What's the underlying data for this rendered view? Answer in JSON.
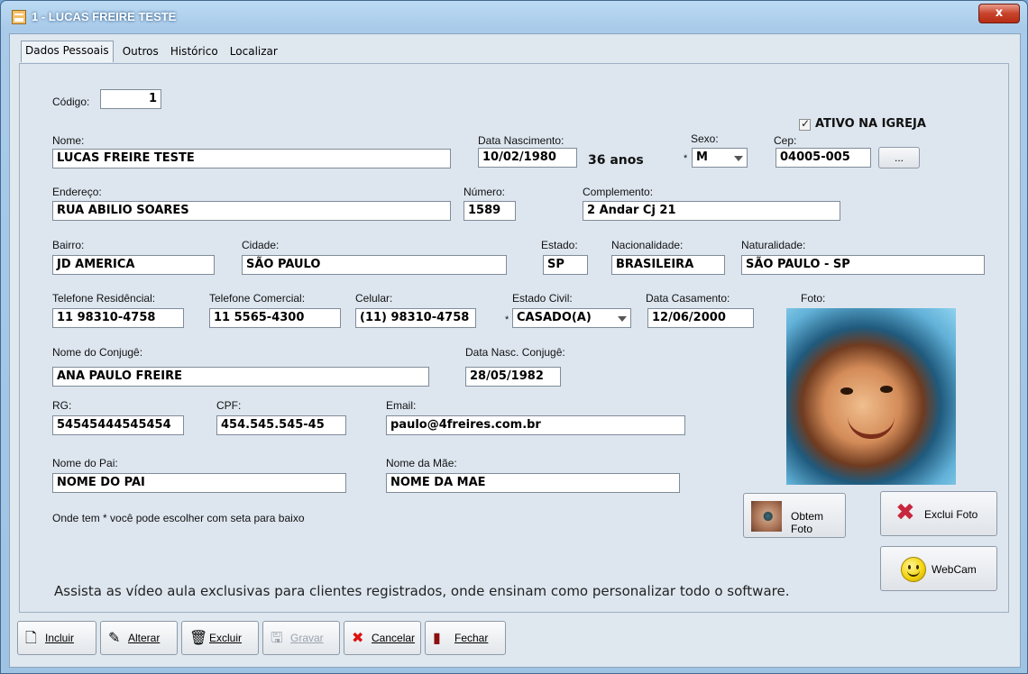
{
  "window": {
    "title": "1 - LUCAS FREIRE TESTE",
    "close": "x"
  },
  "tabs": [
    "Dados Pessoais",
    "Outros",
    "Histórico",
    "Localizar"
  ],
  "codigo": {
    "label": "Código:",
    "value": "1"
  },
  "ativo": {
    "label": "ATIVO NA IGREJA",
    "checked": true
  },
  "nome": {
    "label": "Nome:",
    "value": "LUCAS FREIRE TESTE"
  },
  "nascimento": {
    "label": "Data Nascimento:",
    "value": "10/02/1980",
    "age": "36 anos"
  },
  "sexo": {
    "label": "Sexo:",
    "value": "M"
  },
  "cep": {
    "label": "Cep:",
    "value": "04005-005",
    "button": "..."
  },
  "endereco": {
    "label": "Endereço:",
    "value": "RUA ABILIO SOARES"
  },
  "numero": {
    "label": "Número:",
    "value": "1589"
  },
  "complemento": {
    "label": "Complemento:",
    "value": "2 Andar Cj 21"
  },
  "bairro": {
    "label": "Bairro:",
    "value": "JD AMERICA"
  },
  "cidade": {
    "label": "Cidade:",
    "value": "SÃO PAULO"
  },
  "estado": {
    "label": "Estado:",
    "value": "SP"
  },
  "nacionalidade": {
    "label": "Nacionalidade:",
    "value": "BRASILEIRA"
  },
  "naturalidade": {
    "label": "Naturalidade:",
    "value": "SÃO PAULO - SP"
  },
  "tel_res": {
    "label": "Telefone Residêncial:",
    "value": "11 98310-4758"
  },
  "tel_com": {
    "label": "Telefone Comercial:",
    "value": "11 5565-4300"
  },
  "celular": {
    "label": "Celular:",
    "value": "(11) 98310-4758"
  },
  "estado_civil": {
    "label": "Estado Civil:",
    "value": "CASADO(A)"
  },
  "casamento": {
    "label": "Data Casamento:",
    "value": "12/06/2000"
  },
  "foto": {
    "label": "Foto:"
  },
  "conjuge": {
    "label": "Nome do Conjugê:",
    "value": "ANA PAULO FREIRE"
  },
  "nasc_conjuge": {
    "label": "Data Nasc. Conjugê:",
    "value": "28/05/1982"
  },
  "rg": {
    "label": "RG:",
    "value": "54545444545454"
  },
  "cpf": {
    "label": "CPF:",
    "value": "454.545.545-45"
  },
  "email": {
    "label": "Email:",
    "value": "paulo@4freires.com.br"
  },
  "pai": {
    "label": "Nome do Pai:",
    "value": "NOME DO PAI"
  },
  "mae": {
    "label": "Nome da Mãe:",
    "value": "NOME DA MAE"
  },
  "hint": "Onde tem * você pode escolher com seta para baixo",
  "required_marker": "*",
  "photo_buttons": {
    "obtem": "Obtem Foto",
    "exclui": "Exclui Foto",
    "webcam": "WebCam"
  },
  "info": "Assista as vídeo aula exclusivas para clientes registrados, onde ensinam como personalizar todo o software.",
  "toolbar": {
    "incluir": "Incluir",
    "alterar": "Alterar",
    "excluir": "Excluir",
    "gravar": "Gravar",
    "cancelar": "Cancelar",
    "fechar": "Fechar"
  },
  "colors": {
    "window_border": "#44688e",
    "panel": "#dde6ef",
    "close": "#c8432b"
  }
}
